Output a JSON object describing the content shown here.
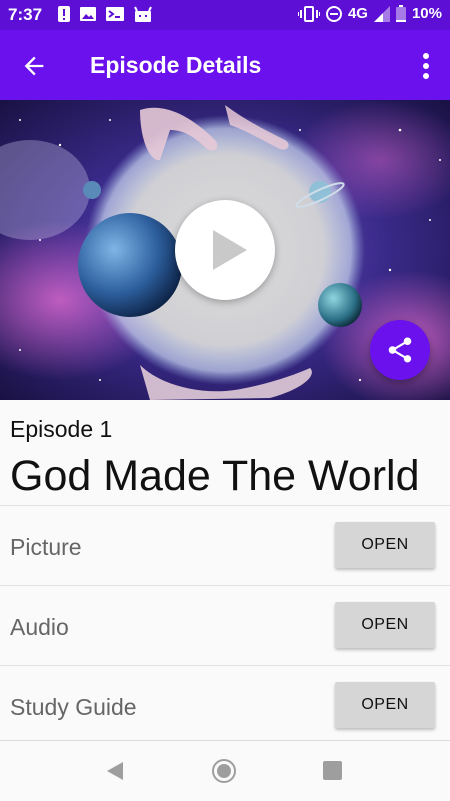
{
  "status_bar": {
    "time": "7:37",
    "network": "4G",
    "battery": "10%",
    "icons_left": [
      "alert-icon",
      "image-icon",
      "terminal-icon",
      "android-icon"
    ],
    "icons_right": [
      "vibrate-icon",
      "do-not-disturb-icon",
      "signal-icon",
      "battery-icon"
    ]
  },
  "app_bar": {
    "title": "Episode Details",
    "back_icon": "arrow-back-icon",
    "more_icon": "more-vert-icon",
    "color": "#6a11ee"
  },
  "hero": {
    "description_icon": "play-icon",
    "share_icon": "share-icon"
  },
  "episode": {
    "number": "Episode 1",
    "title": "God Made The World"
  },
  "resources": [
    {
      "label": "Picture",
      "button": "OPEN"
    },
    {
      "label": "Audio",
      "button": "OPEN"
    },
    {
      "label": "Study Guide",
      "button": "OPEN"
    }
  ],
  "nav_bar": {
    "back": "nav-back-icon",
    "home": "nav-home-icon",
    "recents": "nav-recents-icon"
  }
}
